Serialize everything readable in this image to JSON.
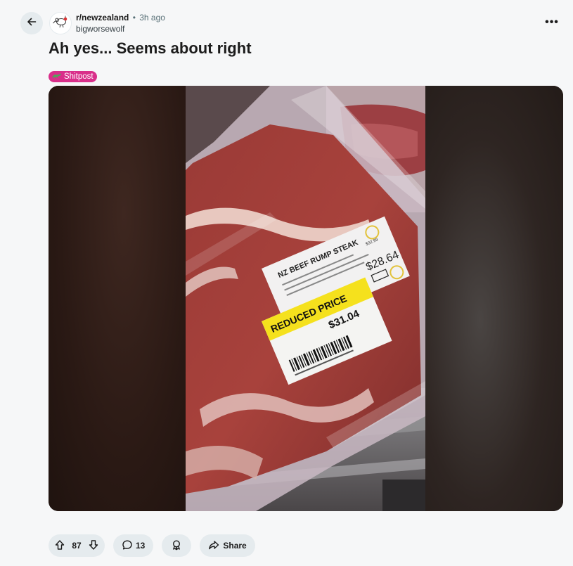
{
  "header": {
    "back_icon": "arrow-left-icon",
    "subreddit": "r/newzealand",
    "separator": "•",
    "time": "3h ago",
    "author": "bigworsewolf",
    "overflow_label": "•••"
  },
  "post": {
    "title": "Ah yes... Seems about right",
    "flair": {
      "label": "Shitpost",
      "color": "#d92f8a"
    },
    "image": {
      "product_label": "NZ BEEF RUMP STEAK",
      "sticker_heading": "REDUCED PRICE",
      "reduced_price": "$31.04",
      "original_price": "$28.64",
      "unit_price": "$32.99"
    }
  },
  "actions": {
    "upvote_icon": "arrow-up-icon",
    "vote_count": "87",
    "downvote_icon": "arrow-down-icon",
    "comment_count": "13",
    "award_icon": "award-icon",
    "share_label": "Share"
  },
  "colors": {
    "background": "#f6f7f8",
    "pill": "#e5ebee",
    "flair": "#d92f8a"
  }
}
